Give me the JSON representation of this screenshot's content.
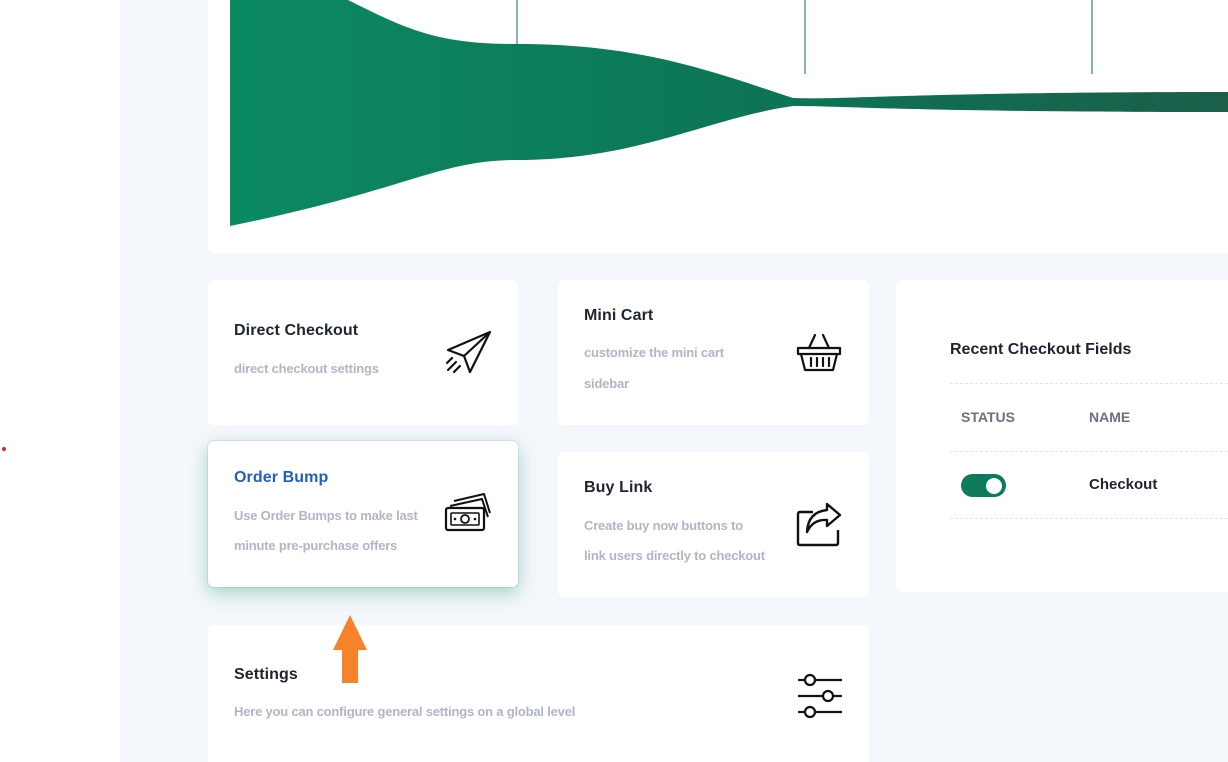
{
  "cards": {
    "direct_checkout": {
      "title": "Direct Checkout",
      "desc": "direct checkout settings"
    },
    "mini_cart": {
      "title": "Mini Cart",
      "desc_line1": "customize the mini cart",
      "desc_line2": "sidebar"
    },
    "order_bump": {
      "title": "Order Bump",
      "desc_line1": "Use Order Bumps to make last",
      "desc_line2": "minute pre-purchase offers"
    },
    "buy_link": {
      "title": "Buy Link",
      "desc_line1": "Create buy now buttons to",
      "desc_line2": "link users directly to checkout"
    },
    "settings": {
      "title": "Settings",
      "desc": "Here you can configure general settings on a global level"
    }
  },
  "recent": {
    "title": "Recent Checkout Fields",
    "columns": {
      "status": "STATUS",
      "name": "NAME"
    },
    "rows": [
      {
        "status_on": true,
        "name": "Checkout"
      }
    ]
  },
  "colors": {
    "accent": "#0e7a5c",
    "highlight_title": "#1f5fbf",
    "arrow": "#f5832a",
    "page_bg": "#f4f7fb"
  },
  "icons": {
    "direct_checkout": "paper-plane-icon",
    "mini_cart": "basket-icon",
    "order_bump": "money-icon",
    "buy_link": "share-icon",
    "settings": "sliders-icon"
  }
}
